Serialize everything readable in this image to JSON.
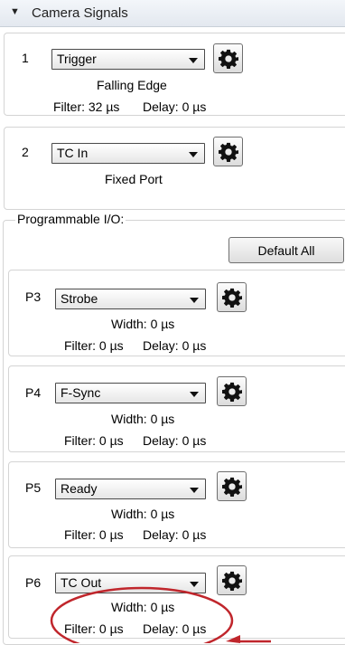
{
  "header": {
    "title": "Camera Signals"
  },
  "signals": [
    {
      "num": "1",
      "value": "Trigger",
      "line1": "Falling Edge",
      "filter": "Filter: 32 µs",
      "delay": "Delay: 0 µs"
    },
    {
      "num": "2",
      "value": "TC In",
      "line1": "Fixed Port"
    }
  ],
  "programmable": {
    "label": "Programmable I/O:",
    "default_all": "Default All",
    "ports": [
      {
        "num": "P3",
        "value": "Strobe",
        "width": "Width: 0 µs",
        "filter": "Filter: 0 µs",
        "delay": "Delay: 0 µs"
      },
      {
        "num": "P4",
        "value": "F-Sync",
        "width": "Width: 0 µs",
        "filter": "Filter: 0 µs",
        "delay": "Delay: 0 µs"
      },
      {
        "num": "P5",
        "value": "Ready",
        "width": "Width: 0 µs",
        "filter": "Filter: 0 µs",
        "delay": "Delay: 0 µs"
      },
      {
        "num": "P6",
        "value": "TC Out",
        "width": "Width: 0 µs",
        "filter": "Filter: 0 µs",
        "delay": "Delay: 0 µs"
      }
    ]
  },
  "icons": {
    "expand": "collapse-triangle-icon",
    "settings": "gear-icon"
  },
  "colors": {
    "annotation": "#c0262c"
  }
}
